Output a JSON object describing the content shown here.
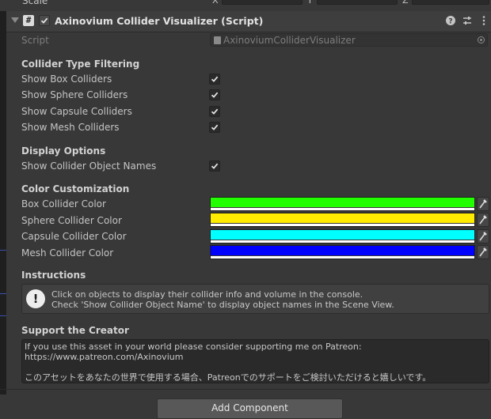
{
  "top_row": {
    "label": "Scale",
    "axes": [
      "X",
      "Y",
      "Z"
    ]
  },
  "header": {
    "script_icon": "hash-script-icon",
    "enabled": true,
    "title": "Axinovium Collider Visualizer (Script)",
    "icons": [
      "help-icon",
      "preset-sliders-icon",
      "more-vertical-icon"
    ]
  },
  "script_row": {
    "label": "Script",
    "value": "AxinoviumColliderVisualizer"
  },
  "collider_filtering": {
    "heading": "Collider Type Filtering",
    "items": [
      {
        "label": "Show Box Colliders",
        "checked": true
      },
      {
        "label": "Show Sphere Colliders",
        "checked": true
      },
      {
        "label": "Show Capsule Colliders",
        "checked": true
      },
      {
        "label": "Show Mesh Colliders",
        "checked": true
      }
    ]
  },
  "display_options": {
    "heading": "Display Options",
    "items": [
      {
        "label": "Show Collider Object Names",
        "checked": true
      }
    ]
  },
  "color_customization": {
    "heading": "Color Customization",
    "items": [
      {
        "label": "Box Collider Color",
        "color": "#22ff00"
      },
      {
        "label": "Sphere Collider Color",
        "color": "#ffeb00"
      },
      {
        "label": "Capsule Collider Color",
        "color": "#00ffff"
      },
      {
        "label": "Mesh Collider Color",
        "color": "#0000ff"
      }
    ]
  },
  "instructions": {
    "heading": "Instructions",
    "icon": "info-exclamation-icon",
    "line1": "Click on objects to display their collider info and volume in the console.",
    "line2": "Check 'Show Collider Object Name' to display object names in the Scene View."
  },
  "support": {
    "heading": "Support the Creator",
    "line1": "If you use this asset in your world please consider supporting me on Patreon:",
    "line2": "https://www.patreon.com/Axinovium",
    "line3": "",
    "line4": "このアセットをあなたの世界で使用する場合、Patreonでのサポートをご検討いただけると嬉しいです。"
  },
  "add_component": {
    "label": "Add Component"
  }
}
